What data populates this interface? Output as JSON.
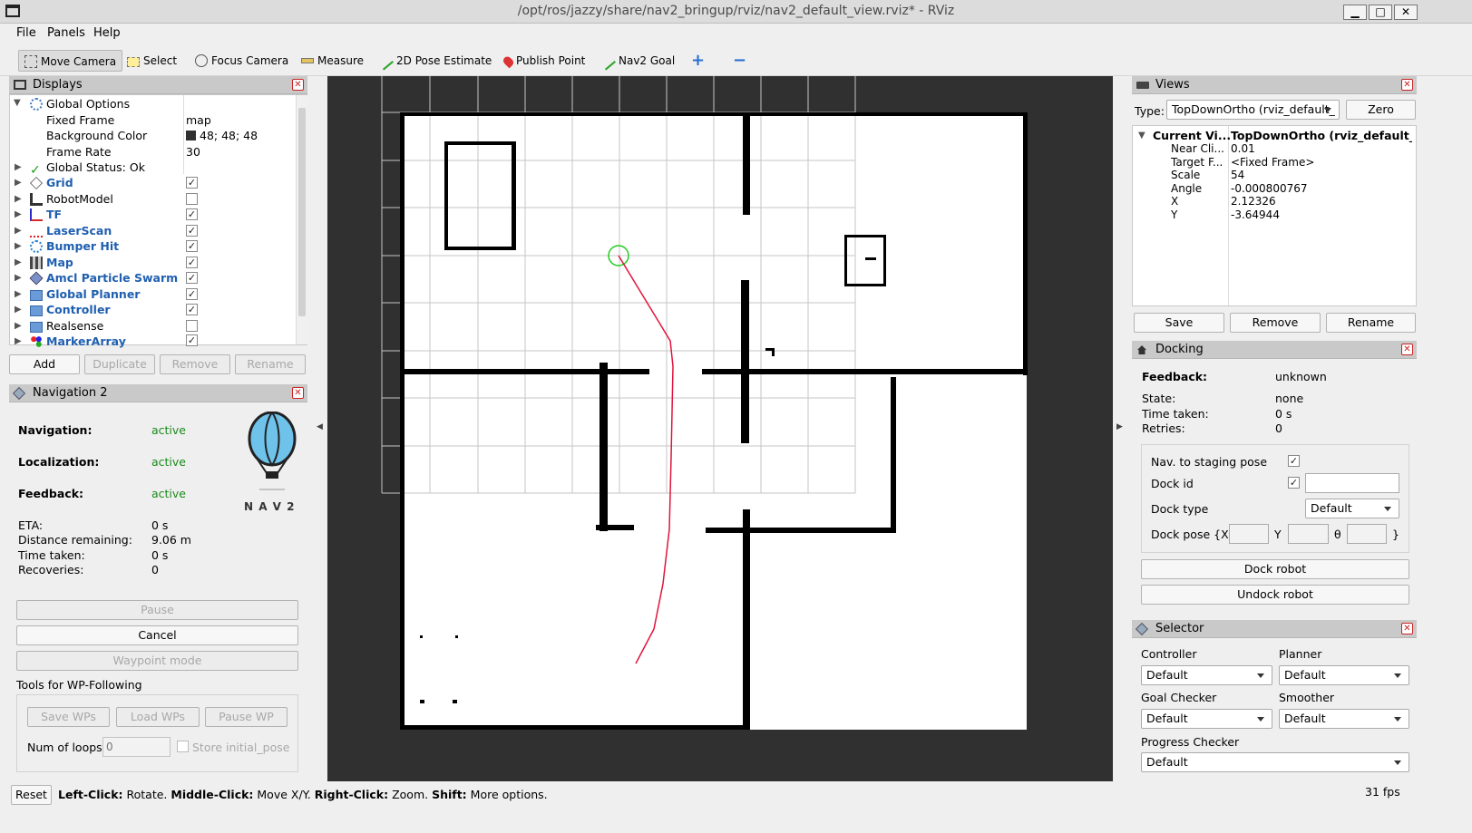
{
  "window": {
    "title": "/opt/ros/jazzy/share/nav2_bringup/rviz/nav2_default_view.rviz* - RViz",
    "min": "▁",
    "max": "□",
    "close": "✕"
  },
  "menu": [
    "File",
    "Panels",
    "Help"
  ],
  "toolbar": {
    "move_camera": "Move Camera",
    "select": "Select",
    "focus_camera": "Focus Camera",
    "measure": "Measure",
    "pose_estimate": "2D Pose Estimate",
    "publish_point": "Publish Point",
    "nav2_goal": "Nav2 Goal",
    "add": "+",
    "remove": "−"
  },
  "displays": {
    "title": "Displays",
    "global_options": "Global Options",
    "fixed_frame_label": "Fixed Frame",
    "fixed_frame": "map",
    "bg_label": "Background Color",
    "bg_value": "48; 48; 48",
    "rate_label": "Frame Rate",
    "rate_value": "30",
    "status": "Global Status: Ok",
    "items": [
      {
        "label": "Grid",
        "checked": true
      },
      {
        "label": "RobotModel",
        "checked": false
      },
      {
        "label": "TF",
        "checked": true
      },
      {
        "label": "LaserScan",
        "checked": true
      },
      {
        "label": "Bumper Hit",
        "checked": true
      },
      {
        "label": "Map",
        "checked": true
      },
      {
        "label": "Amcl Particle Swarm",
        "checked": true
      },
      {
        "label": "Global Planner",
        "checked": true
      },
      {
        "label": "Controller",
        "checked": true
      },
      {
        "label": "Realsense",
        "checked": false
      },
      {
        "label": "MarkerArray",
        "checked": true
      }
    ],
    "add": "Add",
    "duplicate": "Duplicate",
    "remove": "Remove",
    "rename": "Rename"
  },
  "nav2": {
    "title": "Navigation 2",
    "navigation_label": "Navigation:",
    "navigation": "active",
    "localization_label": "Localization:",
    "localization": "active",
    "feedback_label": "Feedback:",
    "feedback": "active",
    "logo_text": "N A V 2",
    "eta_label": "ETA:",
    "eta": "0 s",
    "dist_label": "Distance remaining:",
    "dist": "9.06 m",
    "time_label": "Time taken:",
    "time": "0 s",
    "rec_label": "Recoveries:",
    "rec": "0",
    "pause": "Pause",
    "cancel": "Cancel",
    "waypoint": "Waypoint mode",
    "wp_tools": "Tools for WP-Following",
    "save_wps": "Save WPs",
    "load_wps": "Load WPs",
    "pause_wp": "Pause WP",
    "loops_label": "Num of loops",
    "loops_placeholder": "0",
    "store_pose": "Store initial_pose"
  },
  "views": {
    "title": "Views",
    "type_label": "Type:",
    "type_value": "TopDownOrtho (rviz_default_",
    "zero": "Zero",
    "current_label": "Current Vi...",
    "current_value": "TopDownOrtho (rviz_default_...",
    "props": [
      {
        "k": "Near Cli...",
        "v": "0.01"
      },
      {
        "k": "Target F...",
        "v": "<Fixed Frame>"
      },
      {
        "k": "Scale",
        "v": "54"
      },
      {
        "k": "Angle",
        "v": "-0.000800767"
      },
      {
        "k": "X",
        "v": "2.12326"
      },
      {
        "k": "Y",
        "v": "-3.64944"
      }
    ],
    "save": "Save",
    "remove": "Remove",
    "rename": "Rename"
  },
  "docking": {
    "title": "Docking",
    "feedback_label": "Feedback:",
    "feedback": "unknown",
    "state_label": "State:",
    "state": "none",
    "time_label": "Time taken:",
    "time": "0 s",
    "retries_label": "Retries:",
    "retries": "0",
    "staging_label": "Nav. to staging pose",
    "dockid_label": "Dock id",
    "docktype_label": "Dock type",
    "docktype": "Default",
    "pose_label": "Dock pose {X",
    "y": "Y",
    "theta": "θ",
    "close": "}",
    "dock": "Dock robot",
    "undock": "Undock robot"
  },
  "selector": {
    "title": "Selector",
    "controller_label": "Controller",
    "controller": "Default",
    "planner_label": "Planner",
    "planner": "Default",
    "goal_label": "Goal Checker",
    "goal": "Default",
    "smoother_label": "Smoother",
    "smoother": "Default",
    "progress_label": "Progress Checker",
    "progress": "Default"
  },
  "status": {
    "reset": "Reset",
    "l1": "Left-Click:",
    "t1": " Rotate. ",
    "l2": "Middle-Click:",
    "t2": " Move X/Y. ",
    "l3": "Right-Click:",
    "t3": " Zoom. ",
    "l4": "Shift:",
    "t4": " More options.",
    "fps": "31 fps"
  },
  "colors": {
    "viewport_bg": "#303030",
    "path": "#e0143c",
    "goal_marker": "#22cc22",
    "link_blue": "#1f5fb0"
  }
}
